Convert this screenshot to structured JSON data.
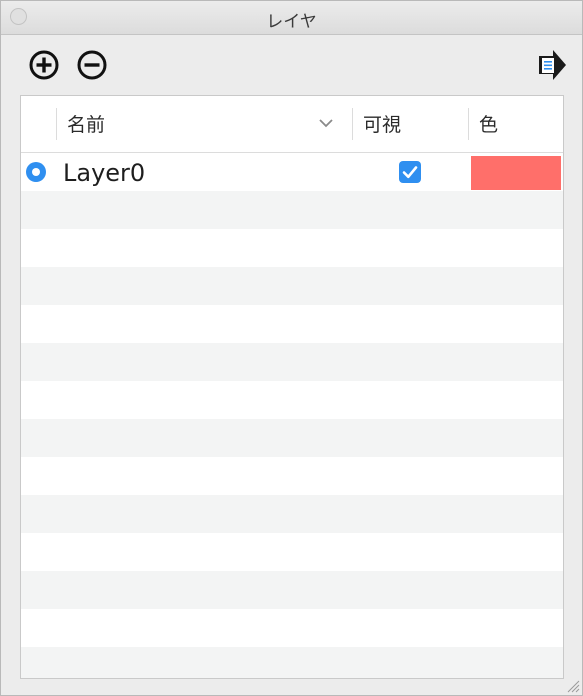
{
  "window": {
    "title": "レイヤ"
  },
  "toolbar": {
    "add_icon": "plus-circle-icon",
    "remove_icon": "minus-circle-icon",
    "export_icon": "export-arrow-icon"
  },
  "table": {
    "columns": {
      "name": "名前",
      "visible": "可視",
      "color": "色"
    },
    "sort_indicator": "chevron-down-icon",
    "rows": [
      {
        "active": true,
        "name": "Layer0",
        "visible": true,
        "color": "#ff6f6a"
      }
    ]
  },
  "colors": {
    "accent": "#2f8ff0",
    "row_alt": "#f3f4f4",
    "layer_color": "#ff6f6a"
  }
}
